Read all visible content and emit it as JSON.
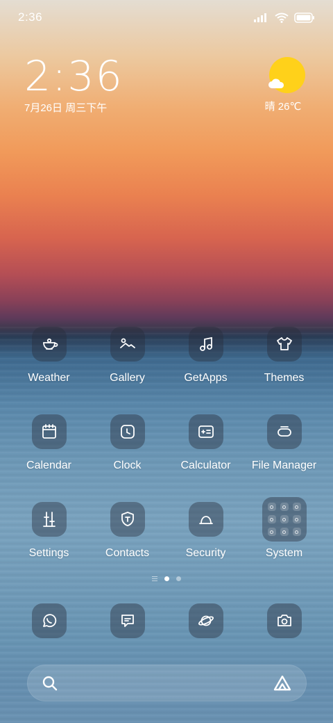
{
  "status_bar": {
    "time": "2:36"
  },
  "clock_widget": {
    "time": "2:36",
    "date": "7月26日 周三下午"
  },
  "weather_widget": {
    "condition_temp": "晴 26℃"
  },
  "apps": [
    {
      "label": "Weather",
      "icon": "weather-cup-icon"
    },
    {
      "label": "Gallery",
      "icon": "gallery-mountain-icon"
    },
    {
      "label": "GetApps",
      "icon": "music-note-icon"
    },
    {
      "label": "Themes",
      "icon": "shirt-icon"
    },
    {
      "label": "Calendar",
      "icon": "calendar-icon"
    },
    {
      "label": "Clock",
      "icon": "clock-icon"
    },
    {
      "label": "Calculator",
      "icon": "calculator-icon"
    },
    {
      "label": "File Manager",
      "icon": "folder-box-icon"
    },
    {
      "label": "Settings",
      "icon": "sliders-icon"
    },
    {
      "label": "Contacts",
      "icon": "shield-contact-icon"
    },
    {
      "label": "Security",
      "icon": "dome-icon"
    },
    {
      "label": "System",
      "icon": "app-folder-icon"
    }
  ],
  "pager": {
    "pages": 2,
    "active_page": 1
  },
  "dock": [
    {
      "app": "WhatsApp",
      "icon": "whatsapp-icon"
    },
    {
      "app": "Messages",
      "icon": "message-icon"
    },
    {
      "app": "Browser",
      "icon": "planet-icon"
    },
    {
      "app": "Camera",
      "icon": "camera-icon"
    }
  ],
  "search": {
    "icons": [
      "search-icon",
      "assistant-icon"
    ]
  },
  "colors": {
    "sun": "#ffd11a",
    "icon_bg": "rgba(40,45,60,0.42)",
    "text": "#ffffff"
  }
}
